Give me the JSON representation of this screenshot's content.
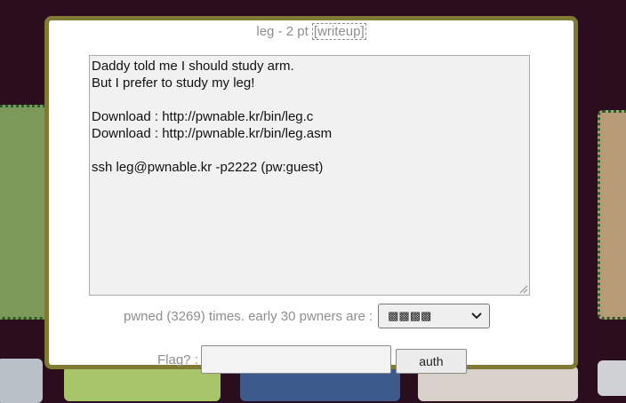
{
  "modal": {
    "title": "leg - 2 pt",
    "writeup_link": "[writeup]",
    "description": "Daddy told me I should study arm.\nBut I prefer to study my leg!\n\nDownload : http://pwnable.kr/bin/leg.c\nDownload : http://pwnable.kr/bin/leg.asm\n\nssh leg@pwnable.kr -p2222 (pw:guest)",
    "stats_text": "pwned (3269) times. early 30 pwners are :",
    "pwners_select": {
      "selected": "▩▩▩▩",
      "icon": "chevron-down-icon"
    },
    "flag_label": "Flag? :",
    "flag_value": "",
    "auth_button": "auth"
  },
  "colors": {
    "backdrop": "#2a0e1e",
    "modal_border": "#807a35",
    "muted_text": "#8e8e8e"
  }
}
